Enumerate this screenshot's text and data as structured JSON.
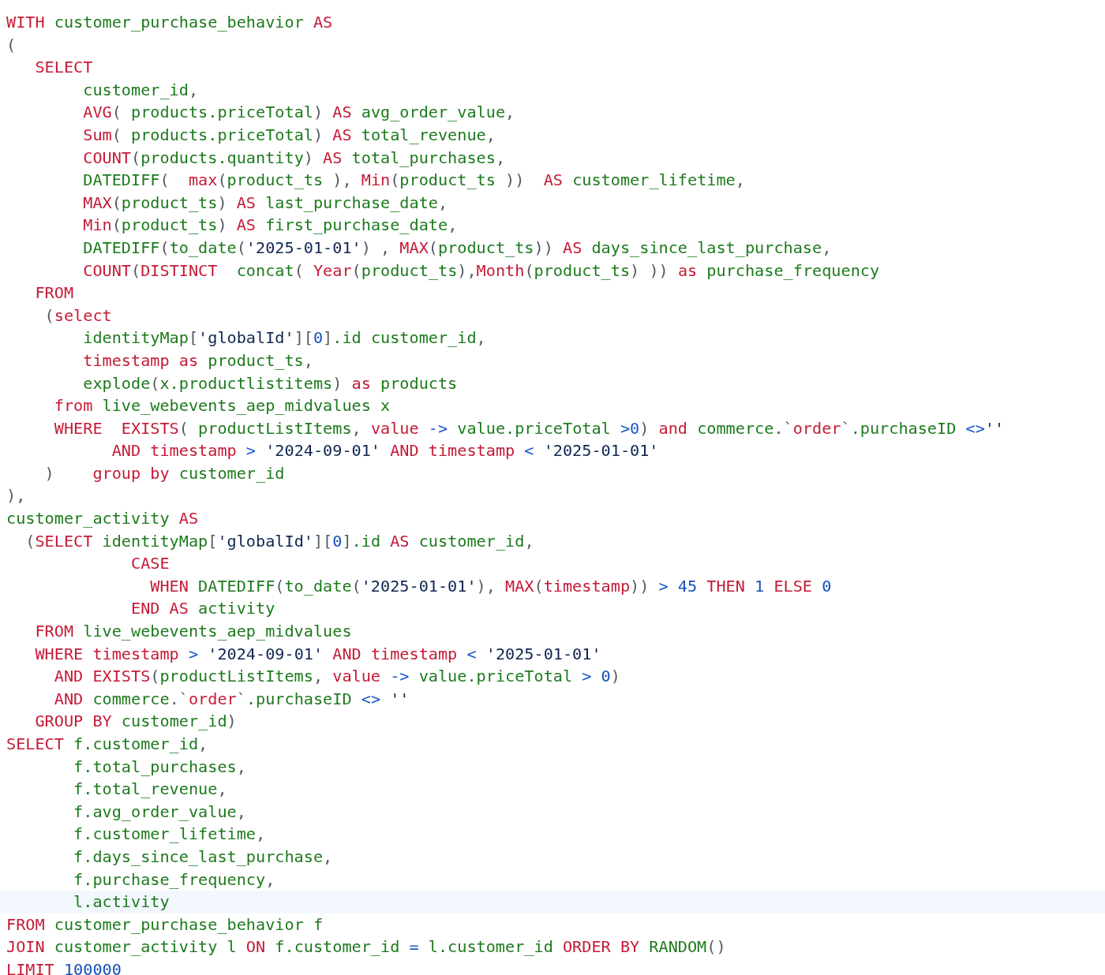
{
  "editor": {
    "lines": [
      {
        "current": false,
        "tokens": [
          {
            "kind": "kw",
            "text": "WITH "
          },
          {
            "kind": "id",
            "text": "customer_purchase_behavior "
          },
          {
            "kind": "kw",
            "text": "AS"
          }
        ]
      },
      {
        "current": false,
        "tokens": [
          {
            "kind": "p",
            "text": "("
          }
        ]
      },
      {
        "current": false,
        "tokens": [
          {
            "kind": "kw",
            "text": "   SELECT"
          }
        ]
      },
      {
        "current": false,
        "tokens": [
          {
            "kind": "id",
            "text": "        customer_id"
          },
          {
            "kind": "p",
            "text": ","
          }
        ]
      },
      {
        "current": false,
        "tokens": [
          {
            "kind": "kw",
            "text": "        AVG"
          },
          {
            "kind": "p",
            "text": "( "
          },
          {
            "kind": "id",
            "text": "products.priceTotal"
          },
          {
            "kind": "p",
            "text": ") "
          },
          {
            "kind": "kw",
            "text": "AS "
          },
          {
            "kind": "id",
            "text": "avg_order_value"
          },
          {
            "kind": "p",
            "text": ","
          }
        ]
      },
      {
        "current": false,
        "tokens": [
          {
            "kind": "kw",
            "text": "        Sum"
          },
          {
            "kind": "p",
            "text": "( "
          },
          {
            "kind": "id",
            "text": "products.priceTotal"
          },
          {
            "kind": "p",
            "text": ") "
          },
          {
            "kind": "kw",
            "text": "AS "
          },
          {
            "kind": "id",
            "text": "total_revenue"
          },
          {
            "kind": "p",
            "text": ","
          }
        ]
      },
      {
        "current": false,
        "tokens": [
          {
            "kind": "kw",
            "text": "        COUNT"
          },
          {
            "kind": "p",
            "text": "("
          },
          {
            "kind": "id",
            "text": "products.quantity"
          },
          {
            "kind": "p",
            "text": ") "
          },
          {
            "kind": "kw",
            "text": "AS "
          },
          {
            "kind": "id",
            "text": "total_purchases"
          },
          {
            "kind": "p",
            "text": ","
          }
        ]
      },
      {
        "current": false,
        "tokens": [
          {
            "kind": "id",
            "text": "        DATEDIFF"
          },
          {
            "kind": "p",
            "text": "(  "
          },
          {
            "kind": "kw",
            "text": "max"
          },
          {
            "kind": "p",
            "text": "("
          },
          {
            "kind": "id",
            "text": "product_ts "
          },
          {
            "kind": "p",
            "text": "), "
          },
          {
            "kind": "kw",
            "text": "Min"
          },
          {
            "kind": "p",
            "text": "("
          },
          {
            "kind": "id",
            "text": "product_ts "
          },
          {
            "kind": "p",
            "text": "))  "
          },
          {
            "kind": "kw",
            "text": "AS "
          },
          {
            "kind": "id",
            "text": "customer_lifetime"
          },
          {
            "kind": "p",
            "text": ","
          }
        ]
      },
      {
        "current": false,
        "tokens": [
          {
            "kind": "kw",
            "text": "        MAX"
          },
          {
            "kind": "p",
            "text": "("
          },
          {
            "kind": "id",
            "text": "product_ts"
          },
          {
            "kind": "p",
            "text": ") "
          },
          {
            "kind": "kw",
            "text": "AS "
          },
          {
            "kind": "id",
            "text": "last_purchase_date"
          },
          {
            "kind": "p",
            "text": ","
          }
        ]
      },
      {
        "current": false,
        "tokens": [
          {
            "kind": "kw",
            "text": "        Min"
          },
          {
            "kind": "p",
            "text": "("
          },
          {
            "kind": "id",
            "text": "product_ts"
          },
          {
            "kind": "p",
            "text": ") "
          },
          {
            "kind": "kw",
            "text": "AS "
          },
          {
            "kind": "id",
            "text": "first_purchase_date"
          },
          {
            "kind": "p",
            "text": ","
          }
        ]
      },
      {
        "current": false,
        "tokens": [
          {
            "kind": "id",
            "text": "        DATEDIFF"
          },
          {
            "kind": "p",
            "text": "("
          },
          {
            "kind": "id",
            "text": "to_date"
          },
          {
            "kind": "p",
            "text": "("
          },
          {
            "kind": "str",
            "text": "'2025-01-01'"
          },
          {
            "kind": "p",
            "text": ") , "
          },
          {
            "kind": "kw",
            "text": "MAX"
          },
          {
            "kind": "p",
            "text": "("
          },
          {
            "kind": "id",
            "text": "product_ts"
          },
          {
            "kind": "p",
            "text": ")) "
          },
          {
            "kind": "kw",
            "text": "AS "
          },
          {
            "kind": "id",
            "text": "days_since_last_purchase"
          },
          {
            "kind": "p",
            "text": ","
          }
        ]
      },
      {
        "current": false,
        "tokens": [
          {
            "kind": "kw",
            "text": "        COUNT"
          },
          {
            "kind": "p",
            "text": "("
          },
          {
            "kind": "kw",
            "text": "DISTINCT  "
          },
          {
            "kind": "id",
            "text": "concat"
          },
          {
            "kind": "p",
            "text": "( "
          },
          {
            "kind": "kw",
            "text": "Year"
          },
          {
            "kind": "p",
            "text": "("
          },
          {
            "kind": "id",
            "text": "product_ts"
          },
          {
            "kind": "p",
            "text": "),"
          },
          {
            "kind": "kw",
            "text": "Month"
          },
          {
            "kind": "p",
            "text": "("
          },
          {
            "kind": "id",
            "text": "product_ts"
          },
          {
            "kind": "p",
            "text": ") )) "
          },
          {
            "kind": "kw",
            "text": "as "
          },
          {
            "kind": "id",
            "text": "purchase_frequency"
          }
        ]
      },
      {
        "current": false,
        "tokens": [
          {
            "kind": "kw",
            "text": "   FROM"
          }
        ]
      },
      {
        "current": false,
        "tokens": [
          {
            "kind": "p",
            "text": "    ("
          },
          {
            "kind": "kw",
            "text": "select"
          }
        ]
      },
      {
        "current": false,
        "tokens": [
          {
            "kind": "id",
            "text": "        identityMap"
          },
          {
            "kind": "p",
            "text": "["
          },
          {
            "kind": "str",
            "text": "'globalId'"
          },
          {
            "kind": "p",
            "text": "]["
          },
          {
            "kind": "num",
            "text": "0"
          },
          {
            "kind": "p",
            "text": "]"
          },
          {
            "kind": "id",
            "text": ".id customer_id"
          },
          {
            "kind": "p",
            "text": ","
          }
        ]
      },
      {
        "current": false,
        "tokens": [
          {
            "kind": "kw",
            "text": "        timestamp as "
          },
          {
            "kind": "id",
            "text": "product_ts"
          },
          {
            "kind": "p",
            "text": ","
          }
        ]
      },
      {
        "current": false,
        "tokens": [
          {
            "kind": "id",
            "text": "        explode"
          },
          {
            "kind": "p",
            "text": "("
          },
          {
            "kind": "id",
            "text": "x.productlistitems"
          },
          {
            "kind": "p",
            "text": ") "
          },
          {
            "kind": "kw",
            "text": "as "
          },
          {
            "kind": "id",
            "text": "products"
          }
        ]
      },
      {
        "current": false,
        "tokens": [
          {
            "kind": "kw",
            "text": "     from "
          },
          {
            "kind": "id",
            "text": "live_webevents_aep_midvalues x"
          }
        ]
      },
      {
        "current": false,
        "tokens": [
          {
            "kind": "kw",
            "text": "     WHERE  EXISTS"
          },
          {
            "kind": "p",
            "text": "( "
          },
          {
            "kind": "id",
            "text": "productListItems"
          },
          {
            "kind": "p",
            "text": ", "
          },
          {
            "kind": "kw",
            "text": "value "
          },
          {
            "kind": "op",
            "text": "-> "
          },
          {
            "kind": "id",
            "text": "value.priceTotal "
          },
          {
            "kind": "op",
            "text": ">0"
          },
          {
            "kind": "p",
            "text": ") "
          },
          {
            "kind": "kw",
            "text": "and "
          },
          {
            "kind": "id",
            "text": "commerce"
          },
          {
            "kind": "p",
            "text": ".`"
          },
          {
            "kind": "kw",
            "text": "order"
          },
          {
            "kind": "p",
            "text": "`"
          },
          {
            "kind": "id",
            "text": ".purchaseID "
          },
          {
            "kind": "op",
            "text": "<>"
          },
          {
            "kind": "str",
            "text": "''"
          }
        ]
      },
      {
        "current": false,
        "tokens": [
          {
            "kind": "kw",
            "text": "           AND timestamp "
          },
          {
            "kind": "op",
            "text": "> "
          },
          {
            "kind": "str",
            "text": "'2024-09-01' "
          },
          {
            "kind": "kw",
            "text": "AND timestamp "
          },
          {
            "kind": "op",
            "text": "< "
          },
          {
            "kind": "str",
            "text": "'2025-01-01'"
          }
        ]
      },
      {
        "current": false,
        "tokens": [
          {
            "kind": "p",
            "text": "    )    "
          },
          {
            "kind": "kw",
            "text": "group by "
          },
          {
            "kind": "id",
            "text": "customer_id"
          }
        ]
      },
      {
        "current": false,
        "tokens": [
          {
            "kind": "p",
            "text": "),"
          }
        ]
      },
      {
        "current": false,
        "tokens": [
          {
            "kind": "id",
            "text": "customer_activity "
          },
          {
            "kind": "kw",
            "text": "AS"
          }
        ]
      },
      {
        "current": false,
        "tokens": [
          {
            "kind": "p",
            "text": "  ("
          },
          {
            "kind": "kw",
            "text": "SELECT "
          },
          {
            "kind": "id",
            "text": "identityMap"
          },
          {
            "kind": "p",
            "text": "["
          },
          {
            "kind": "str",
            "text": "'globalId'"
          },
          {
            "kind": "p",
            "text": "]["
          },
          {
            "kind": "num",
            "text": "0"
          },
          {
            "kind": "p",
            "text": "]"
          },
          {
            "kind": "id",
            "text": ".id "
          },
          {
            "kind": "kw",
            "text": "AS "
          },
          {
            "kind": "id",
            "text": "customer_id"
          },
          {
            "kind": "p",
            "text": ","
          }
        ]
      },
      {
        "current": false,
        "tokens": [
          {
            "kind": "kw",
            "text": "             CASE"
          }
        ]
      },
      {
        "current": false,
        "tokens": [
          {
            "kind": "kw",
            "text": "               WHEN "
          },
          {
            "kind": "id",
            "text": "DATEDIFF"
          },
          {
            "kind": "p",
            "text": "("
          },
          {
            "kind": "id",
            "text": "to_date"
          },
          {
            "kind": "p",
            "text": "("
          },
          {
            "kind": "str",
            "text": "'2025-01-01'"
          },
          {
            "kind": "p",
            "text": "), "
          },
          {
            "kind": "kw",
            "text": "MAX"
          },
          {
            "kind": "p",
            "text": "("
          },
          {
            "kind": "kw",
            "text": "timestamp"
          },
          {
            "kind": "p",
            "text": ")) "
          },
          {
            "kind": "op",
            "text": "> "
          },
          {
            "kind": "num",
            "text": "45 "
          },
          {
            "kind": "kw",
            "text": "THEN "
          },
          {
            "kind": "num",
            "text": "1 "
          },
          {
            "kind": "kw",
            "text": "ELSE "
          },
          {
            "kind": "num",
            "text": "0"
          }
        ]
      },
      {
        "current": false,
        "tokens": [
          {
            "kind": "kw",
            "text": "             END AS "
          },
          {
            "kind": "id",
            "text": "activity"
          }
        ]
      },
      {
        "current": false,
        "tokens": [
          {
            "kind": "kw",
            "text": "   FROM "
          },
          {
            "kind": "id",
            "text": "live_webevents_aep_midvalues"
          }
        ]
      },
      {
        "current": false,
        "tokens": [
          {
            "kind": "kw",
            "text": "   WHERE timestamp "
          },
          {
            "kind": "op",
            "text": "> "
          },
          {
            "kind": "str",
            "text": "'2024-09-01' "
          },
          {
            "kind": "kw",
            "text": "AND timestamp "
          },
          {
            "kind": "op",
            "text": "< "
          },
          {
            "kind": "str",
            "text": "'2025-01-01'"
          }
        ]
      },
      {
        "current": false,
        "tokens": [
          {
            "kind": "kw",
            "text": "     AND EXISTS"
          },
          {
            "kind": "p",
            "text": "("
          },
          {
            "kind": "id",
            "text": "productListItems"
          },
          {
            "kind": "p",
            "text": ", "
          },
          {
            "kind": "kw",
            "text": "value "
          },
          {
            "kind": "op",
            "text": "-> "
          },
          {
            "kind": "id",
            "text": "value.priceTotal "
          },
          {
            "kind": "op",
            "text": "> "
          },
          {
            "kind": "num",
            "text": "0"
          },
          {
            "kind": "p",
            "text": ")"
          }
        ]
      },
      {
        "current": false,
        "tokens": [
          {
            "kind": "kw",
            "text": "     AND "
          },
          {
            "kind": "id",
            "text": "commerce"
          },
          {
            "kind": "p",
            "text": ".`"
          },
          {
            "kind": "kw",
            "text": "order"
          },
          {
            "kind": "p",
            "text": "`"
          },
          {
            "kind": "id",
            "text": ".purchaseID "
          },
          {
            "kind": "op",
            "text": "<> "
          },
          {
            "kind": "str",
            "text": "''"
          }
        ]
      },
      {
        "current": false,
        "tokens": [
          {
            "kind": "kw",
            "text": "   GROUP BY "
          },
          {
            "kind": "id",
            "text": "customer_id"
          },
          {
            "kind": "p",
            "text": ")"
          }
        ]
      },
      {
        "current": false,
        "tokens": [
          {
            "kind": "kw",
            "text": "SELECT "
          },
          {
            "kind": "id",
            "text": "f.customer_id"
          },
          {
            "kind": "p",
            "text": ","
          }
        ]
      },
      {
        "current": false,
        "tokens": [
          {
            "kind": "id",
            "text": "       f.total_purchases"
          },
          {
            "kind": "p",
            "text": ","
          }
        ]
      },
      {
        "current": false,
        "tokens": [
          {
            "kind": "id",
            "text": "       f.total_revenue"
          },
          {
            "kind": "p",
            "text": ","
          }
        ]
      },
      {
        "current": false,
        "tokens": [
          {
            "kind": "id",
            "text": "       f.avg_order_value"
          },
          {
            "kind": "p",
            "text": ","
          }
        ]
      },
      {
        "current": false,
        "tokens": [
          {
            "kind": "id",
            "text": "       f.customer_lifetime"
          },
          {
            "kind": "p",
            "text": ","
          }
        ]
      },
      {
        "current": false,
        "tokens": [
          {
            "kind": "id",
            "text": "       f.days_since_last_purchase"
          },
          {
            "kind": "p",
            "text": ","
          }
        ]
      },
      {
        "current": false,
        "tokens": [
          {
            "kind": "id",
            "text": "       f.purchase_frequency"
          },
          {
            "kind": "p",
            "text": ","
          }
        ]
      },
      {
        "current": true,
        "tokens": [
          {
            "kind": "id",
            "text": "       l.activity"
          }
        ]
      },
      {
        "current": false,
        "tokens": [
          {
            "kind": "kw",
            "text": "FROM "
          },
          {
            "kind": "id",
            "text": "customer_purchase_behavior f"
          }
        ]
      },
      {
        "current": false,
        "tokens": [
          {
            "kind": "kw",
            "text": "JOIN "
          },
          {
            "kind": "id",
            "text": "customer_activity l "
          },
          {
            "kind": "kw",
            "text": "ON "
          },
          {
            "kind": "id",
            "text": "f.customer_id "
          },
          {
            "kind": "op",
            "text": "= "
          },
          {
            "kind": "id",
            "text": "l.customer_id "
          },
          {
            "kind": "kw",
            "text": "ORDER BY "
          },
          {
            "kind": "id",
            "text": "RANDOM"
          },
          {
            "kind": "p",
            "text": "()"
          }
        ]
      },
      {
        "current": false,
        "tokens": [
          {
            "kind": "kw",
            "text": "LIMIT "
          },
          {
            "kind": "num",
            "text": "100000"
          }
        ]
      }
    ]
  }
}
